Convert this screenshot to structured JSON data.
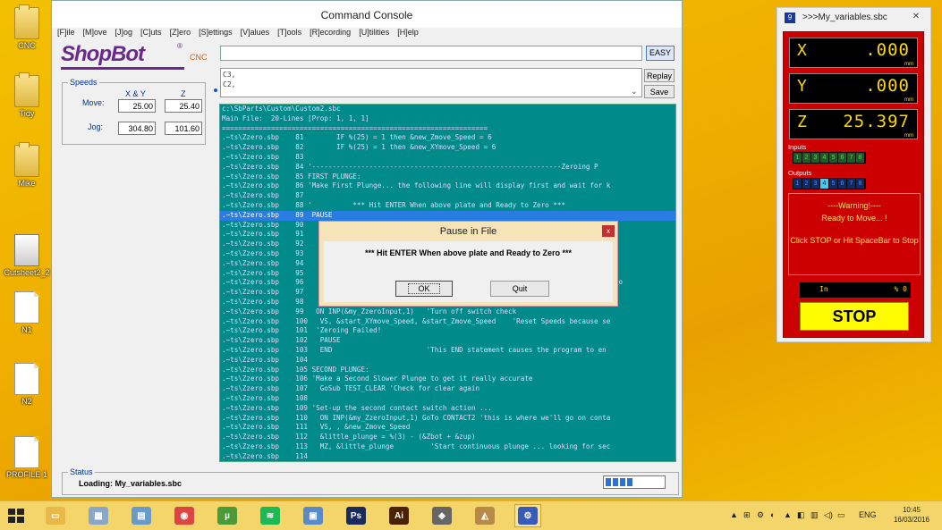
{
  "desktop": {
    "icons": [
      {
        "label": "CNC",
        "kind": "folder"
      },
      {
        "label": "Tidy",
        "kind": "folder"
      },
      {
        "label": "Mike",
        "kind": "folder"
      },
      {
        "label": "Cutsheet2_2",
        "kind": "screenshot"
      },
      {
        "label": "N1",
        "kind": "document"
      },
      {
        "label": "N2",
        "kind": "document"
      },
      {
        "label": "PROFILE 1",
        "kind": "document"
      }
    ]
  },
  "command_console": {
    "title": "Command Console",
    "menu": [
      "[F]ile",
      "[M]ove",
      "[J]og",
      "[C]uts",
      "[Z]ero",
      "[S]ettings",
      "[V]alues",
      "[T]ools",
      "[R]ecording",
      "[U]tilities",
      "[H]elp"
    ],
    "logo": {
      "word": "ShopBot",
      "mark": "®",
      "tag": "CNC"
    },
    "speeds": {
      "legend": "Speeds",
      "col_xy": "X & Y",
      "col_z": "Z",
      "move_label": "Move:",
      "jog_label": "Jog:",
      "move_xy": "25.00",
      "move_z": "25.40",
      "jog_xy": "304.80",
      "jog_z": "101.60"
    },
    "command_input": "",
    "easy_label": "EASY",
    "history": [
      "C3,",
      "C2,"
    ],
    "replay_label": "Replay",
    "save_label": "Save",
    "code_lines": [
      "c:\\SbParts\\Custom\\Custom2.sbc",
      "Main File:  20-Lines [Prop: 1, 1, 1]",
      "=================================================================",
      ".~ts\\Zzero.sbp    81        IF %(25) = 1 then &new_Zmove_Speed = 6",
      ".~ts\\Zzero.sbp    82        IF %(25) = 1 then &new_XYmove_Speed = 6",
      ".~ts\\Zzero.sbp    83",
      ".~ts\\Zzero.sbp    84 '-------------------------------------------------------------Zeroing P",
      ".~ts\\Zzero.sbp    85 FIRST PLUNGE:",
      ".~ts\\Zzero.sbp    86 'Make First Plunge... the following line will display first and wait for k",
      ".~ts\\Zzero.sbp    87",
      ".~ts\\Zzero.sbp    88 '          *** Hit ENTER When above plate and Ready to Zero ***",
      ".~ts\\Zzero.sbp    89  PAUSE",
      ".~ts\\Zzero.sbp    90                                                                    already c",
      ".~ts\\Zzero.sbp    91",
      ".~ts\\Zzero.sbp    92",
      ".~ts\\Zzero.sbp    93                                                                    on contac",
      ".~ts\\Zzero.sbp    94",
      ".~ts\\Zzero.sbp    95                                                                   o reduce p",
      ".~ts\\Zzero.sbp    96                                                                    looking fo",
      ".~ts\\Zzero.sbp    97",
      ".~ts\\Zzero.sbp    98",
      ".~ts\\Zzero.sbp    99   ON INP(&my_ZzeroInput,1)   'Turn off switch check",
      ".~ts\\Zzero.sbp    100   VS, &start_XYmove_Speed, &start_Zmove_Speed    'Reset Speeds because se",
      ".~ts\\Zzero.sbp    101  'Zeroing Failed!",
      ".~ts\\Zzero.sbp    102   PAUSE",
      ".~ts\\Zzero.sbp    103   END                       'This END statement causes the program to en",
      ".~ts\\Zzero.sbp    104",
      ".~ts\\Zzero.sbp    105 SECOND PLUNGE:",
      ".~ts\\Zzero.sbp    106 'Make a Second Slower Plunge to get it really accurate",
      ".~ts\\Zzero.sbp    107   GoSub TEST_CLEAR 'Check for clear again",
      ".~ts\\Zzero.sbp    108",
      ".~ts\\Zzero.sbp    109 'Set-up the second contact switch action ...",
      ".~ts\\Zzero.sbp    110   ON INP(&my_ZzeroInput,1) GoTo CONTACT2 'this is where we'll go on conta",
      ".~ts\\Zzero.sbp    111   VS, , &new_Zmove_Speed",
      ".~ts\\Zzero.sbp    112   &little_plunge = %(3) - (&Zbot + &zup)",
      ".~ts\\Zzero.sbp    113   MZ, &little_plunge         'Start continuous plunge ... looking for sec",
      ".~ts\\Zzero.sbp    114"
    ],
    "highlight_line": 11,
    "status": {
      "legend": "Status",
      "message": "Loading: My_variables.sbc",
      "progress": 0.5
    }
  },
  "dialog": {
    "title": "Pause in File",
    "close_glyph": "x",
    "message": "*** Hit ENTER When above plate and Ready to Zero ***",
    "ok_label": "OK",
    "quit_label": "Quit"
  },
  "variables": {
    "title": ">>>My_variables.sbc",
    "icon_glyph": "9",
    "close_glyph": "✕",
    "axes": [
      {
        "axis": "X",
        "value": ".000",
        "unit": "mm"
      },
      {
        "axis": "Y",
        "value": ".000",
        "unit": "mm"
      },
      {
        "axis": "Z",
        "value": "25.397",
        "unit": "mm"
      }
    ],
    "inputs_label": "Inputs",
    "inputs": [
      "1",
      "2",
      "3",
      "4",
      "5",
      "6",
      "7",
      "8"
    ],
    "outputs_label": "Outputs",
    "outputs": [
      "1",
      "2",
      "3",
      "4",
      "5",
      "6",
      "7",
      "8"
    ],
    "outputs_active": [
      3
    ],
    "warning_title": "----Warning!----",
    "warning_msg": "Ready to Move... !",
    "warning_sub": "Click STOP or Hit SpaceBar to Stop",
    "units_left": "In",
    "units_right": "% 0",
    "stop_label": "STOP"
  },
  "taskbar": {
    "apps": [
      {
        "name": "file-explorer",
        "glyph": "▭",
        "color": "#e8b84a"
      },
      {
        "name": "photos",
        "glyph": "▦",
        "color": "#8aa6c8"
      },
      {
        "name": "scanner",
        "glyph": "▤",
        "color": "#6a9ac8"
      },
      {
        "name": "chrome",
        "glyph": "◉",
        "color": "#d44"
      },
      {
        "name": "utorrent",
        "glyph": "µ",
        "color": "#4a9a3a"
      },
      {
        "name": "spotify",
        "glyph": "≋",
        "color": "#1db954"
      },
      {
        "name": "picture-viewer",
        "glyph": "▣",
        "color": "#5a8ac8"
      },
      {
        "name": "photoshop",
        "glyph": "Ps",
        "color": "#1a2a5a"
      },
      {
        "name": "illustrator",
        "glyph": "Ai",
        "color": "#4a2200"
      },
      {
        "name": "cut2d",
        "glyph": "◈",
        "color": "#666"
      },
      {
        "name": "aspire",
        "glyph": "◭",
        "color": "#b88a4a"
      },
      {
        "name": "shopbot",
        "glyph": "⚙",
        "color": "#3a5ab8"
      }
    ],
    "tray_icons": [
      "▲",
      "⊞",
      "⚙",
      "◐",
      "▲",
      "◧",
      "▥",
      "◁)",
      "▭"
    ],
    "language": "ENG",
    "time": "10:45",
    "date": "16/03/2016"
  }
}
